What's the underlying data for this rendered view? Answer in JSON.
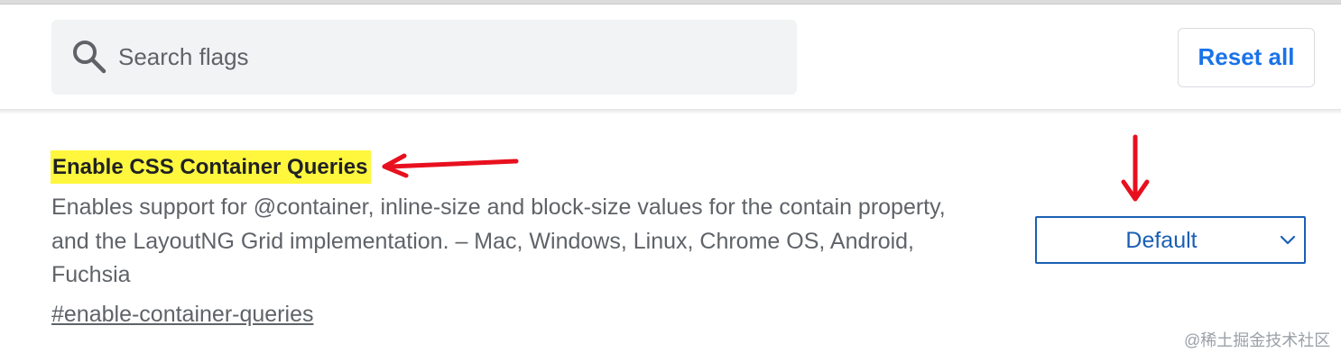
{
  "search": {
    "placeholder": "Search flags",
    "icon": "search-icon"
  },
  "reset_all_label": "Reset all",
  "flag": {
    "title": "Enable CSS Container Queries",
    "description_lines": [
      "Enables support for @container, inline-size and block-size values for the contain property,",
      "and the LayoutNG Grid implementation. – Mac, Windows, Linux, Chrome OS, Android,",
      "Fuchsia"
    ],
    "link": "#enable-container-queries",
    "select_value": "Default"
  },
  "watermark": "@稀土掘金技术社区",
  "colors": {
    "accent": "#1a73e8",
    "select_accent": "#1a5fb4",
    "highlight": "#fff73d",
    "annotation": "#e8101e",
    "search_bg": "#f1f3f4",
    "muted_text": "#5f6368"
  }
}
